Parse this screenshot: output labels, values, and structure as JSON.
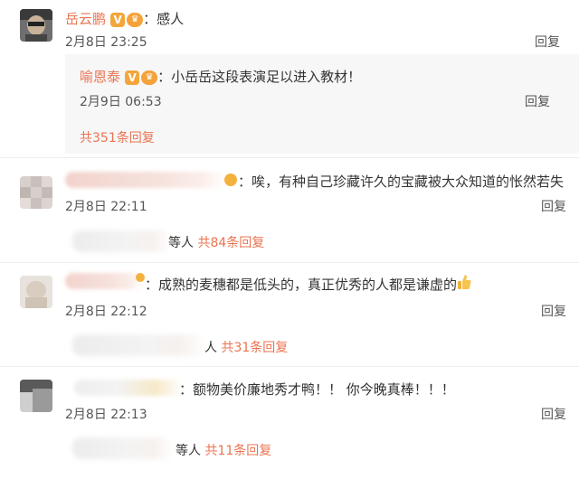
{
  "comment1": {
    "username": "岳云鹏",
    "verified_mark": "V",
    "text": "：感人",
    "time": "2月8日 23:25",
    "reply": "回复"
  },
  "nested": {
    "username": "喻恩泰",
    "verified_mark": "V",
    "text": "：小岳岳这段表演足以进入教材！",
    "time": "2月9日 06:53",
    "reply": "回复"
  },
  "comment1_more": "共351条回复",
  "comment2": {
    "text": "：唉，有种自己珍藏许久的宝藏被大众知道的怅然若失",
    "time": "2月8日 22:11",
    "reply": "回复",
    "sub_prefix": "等人",
    "sub_more": "共84条回复"
  },
  "comment3": {
    "text": "：成熟的麦穗都是低头的，真正优秀的人都是谦虚的",
    "time": "2月8日 22:12",
    "reply": "回复",
    "sub_prefix": "人",
    "sub_more": "共31条回复"
  },
  "comment4": {
    "text": "：额物美价廉地秀才鸭！！ 你今晚真棒！！！",
    "time": "2月8日 22:13",
    "reply": "回复",
    "sub_prefix": "等人",
    "sub_more": "共11条回复"
  },
  "colors": {
    "name": "#eb7350",
    "link": "#eb7350",
    "badge": "#f3a63b",
    "nested_bg": "#f7f7f7"
  },
  "icons": [
    "verified-v-icon",
    "vip-crown-icon",
    "thumbs-up-icon"
  ]
}
